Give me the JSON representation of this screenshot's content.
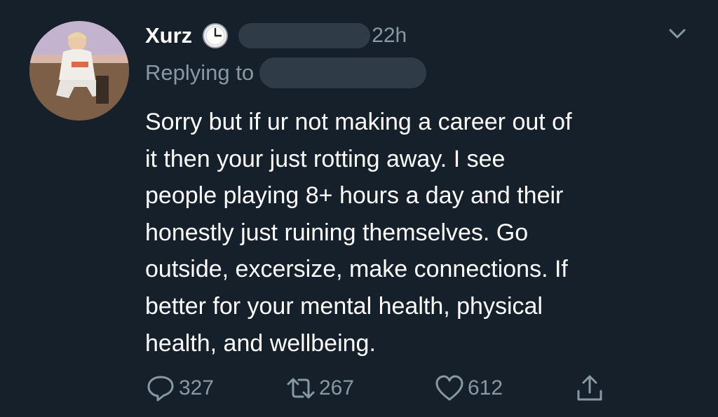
{
  "tweet": {
    "author_name": "Xurz",
    "time": "22h",
    "replying_label": "Replying to",
    "lines": [
      "Sorry but if ur not making a career out of",
      "it then your just rotting away. I see",
      "people playing 8+ hours a day and their",
      "honestly just ruining themselves. Go",
      "outside, excersize, make connections. If",
      "better for your mental health, physical",
      "health, and wellbeing."
    ]
  },
  "actions": {
    "replies": "327",
    "retweets": "267",
    "likes": "612"
  },
  "icons": {
    "badge": "clock-icon",
    "menu": "chevron-down-icon",
    "reply": "reply-icon",
    "retweet": "retweet-icon",
    "like": "heart-icon",
    "share": "share-icon"
  },
  "colors": {
    "background": "#15202b",
    "secondary_text": "#8899a6",
    "redaction": "#2f3b47"
  }
}
